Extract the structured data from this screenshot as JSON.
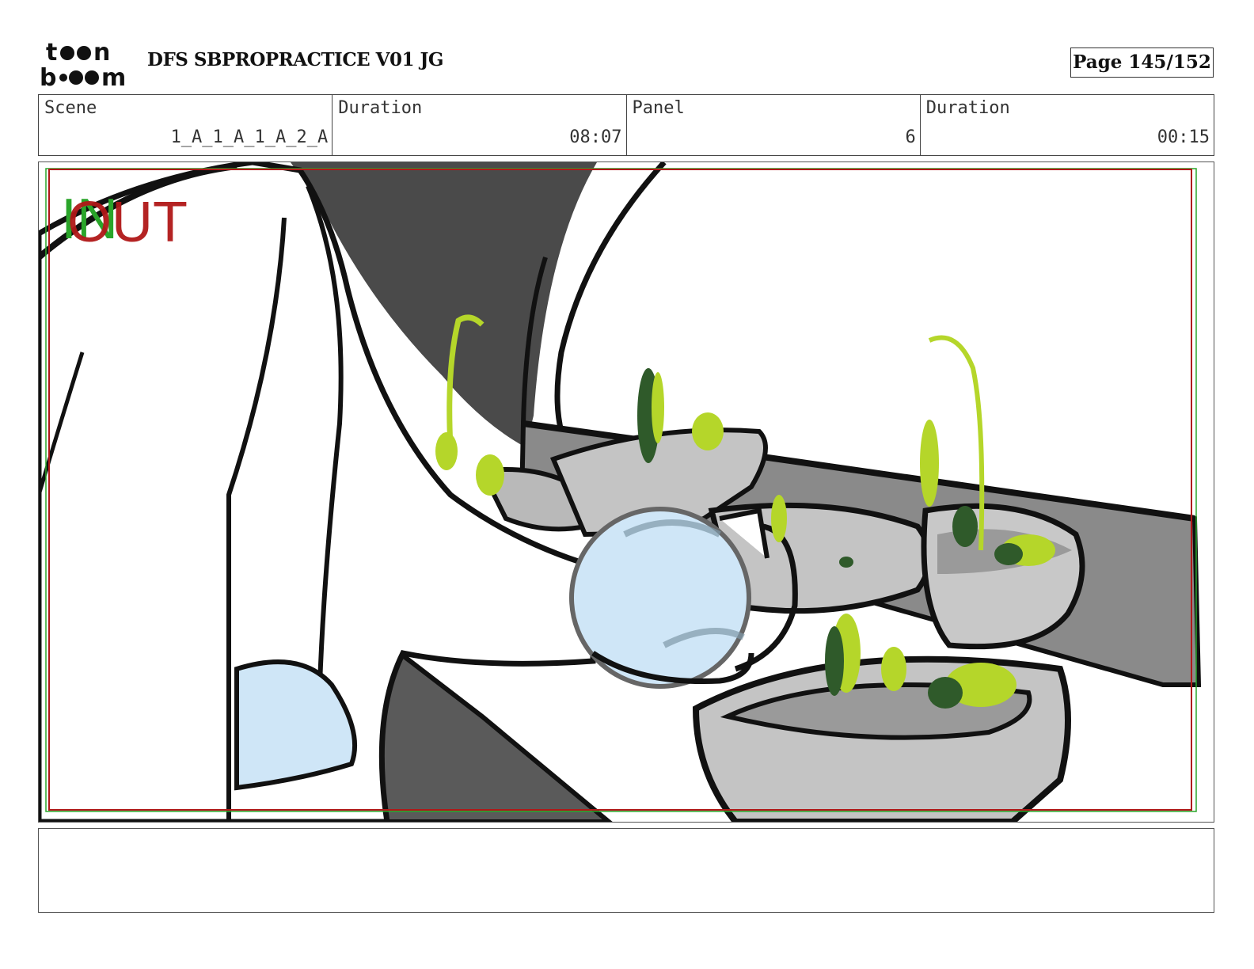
{
  "header": {
    "logo_text": "toonboom",
    "project_title": "DFS SBPROPRACTICE V01 JG",
    "page_label": "Page 145/152"
  },
  "info": {
    "scene_label": "Scene",
    "scene_value": "1_A_1_A_1_A_2_A",
    "scene_duration_label": "Duration",
    "scene_duration_value": "08:07",
    "panel_label": "Panel",
    "panel_value": "6",
    "panel_duration_label": "Duration",
    "panel_duration_value": "00:15"
  },
  "panel": {
    "in_marker": "IN",
    "out_marker": "OUT",
    "colors": {
      "in_marker": "#2aa52a",
      "out_marker": "#b01818",
      "dark_wall": "#4a4a4a",
      "pot_grey": "#c4c4c4",
      "soil_grey": "#9a9a9a",
      "plant_lime": "#b5d62a",
      "plant_dark": "#2f5a2a",
      "water_blue": "#cfe6f7"
    }
  },
  "caption": {
    "text": ""
  }
}
